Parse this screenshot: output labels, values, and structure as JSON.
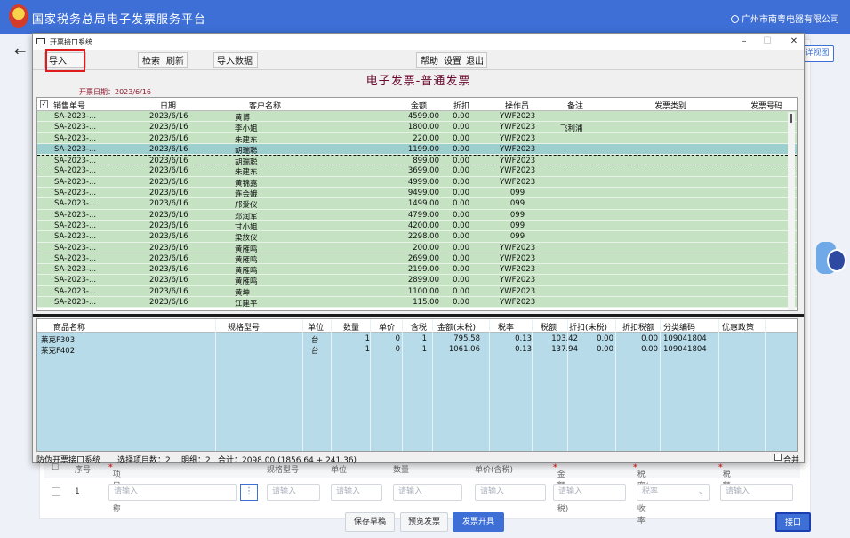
{
  "app": {
    "title": "国家税务总局电子发票服务平台",
    "user": "广州市南粤电器有限公司",
    "view_button": "详视图"
  },
  "dialog": {
    "title": "开票接口系统",
    "menu": {
      "import": "导入",
      "search": "检索",
      "refresh": "刷新",
      "import_data": "导入数据",
      "help": "帮助",
      "settings": "设置",
      "exit": "退出"
    },
    "heading": "电子发票-普通发票",
    "date_label": "开票日期：2023/6/16",
    "invoice_columns": [
      "销售单号",
      "日期",
      "客户名称",
      "金额",
      "折扣",
      "操作员",
      "备注",
      "发票类别",
      "发票号码"
    ],
    "invoices": [
      {
        "no": "SA-2023-...",
        "date": "2023/6/16",
        "customer": "黄博",
        "amount": "4599.00",
        "discount": "0.00",
        "operator": "YWF2023",
        "note": ""
      },
      {
        "no": "SA-2023-...",
        "date": "2023/6/16",
        "customer": "李小姐",
        "amount": "1800.00",
        "discount": "0.00",
        "operator": "YWF2023",
        "note": "飞利浦"
      },
      {
        "no": "SA-2023-...",
        "date": "2023/6/16",
        "customer": "朱建东",
        "amount": "220.00",
        "discount": "0.00",
        "operator": "YWF2023",
        "note": ""
      },
      {
        "no": "SA-2023-...",
        "date": "2023/6/16",
        "customer": "胡瑞聪",
        "amount": "1199.00",
        "discount": "0.00",
        "operator": "YWF2023",
        "note": ""
      },
      {
        "no": "SA-2023-...",
        "date": "2023/6/16",
        "customer": "胡瑞聪",
        "amount": "899.00",
        "discount": "0.00",
        "operator": "YWF2023",
        "note": ""
      },
      {
        "no": "SA-2023-...",
        "date": "2023/6/16",
        "customer": "朱建东",
        "amount": "3699.00",
        "discount": "0.00",
        "operator": "YWF2023",
        "note": ""
      },
      {
        "no": "SA-2023-...",
        "date": "2023/6/16",
        "customer": "黄锦嘉",
        "amount": "4999.00",
        "discount": "0.00",
        "operator": "YWF2023",
        "note": ""
      },
      {
        "no": "SA-2023-...",
        "date": "2023/6/16",
        "customer": "连会娥",
        "amount": "9499.00",
        "discount": "0.00",
        "operator": "099",
        "note": ""
      },
      {
        "no": "SA-2023-...",
        "date": "2023/6/16",
        "customer": "邝爱仪",
        "amount": "1499.00",
        "discount": "0.00",
        "operator": "099",
        "note": ""
      },
      {
        "no": "SA-2023-...",
        "date": "2023/6/16",
        "customer": "邓润军",
        "amount": "4799.00",
        "discount": "0.00",
        "operator": "099",
        "note": ""
      },
      {
        "no": "SA-2023-...",
        "date": "2023/6/16",
        "customer": "甘小姐",
        "amount": "4200.00",
        "discount": "0.00",
        "operator": "099",
        "note": ""
      },
      {
        "no": "SA-2023-...",
        "date": "2023/6/16",
        "customer": "梁放仪",
        "amount": "2298.00",
        "discount": "0.00",
        "operator": "099",
        "note": ""
      },
      {
        "no": "SA-2023-...",
        "date": "2023/6/16",
        "customer": "黄雁鸣",
        "amount": "200.00",
        "discount": "0.00",
        "operator": "YWF2023",
        "note": ""
      },
      {
        "no": "SA-2023-...",
        "date": "2023/6/16",
        "customer": "黄雁鸣",
        "amount": "2699.00",
        "discount": "0.00",
        "operator": "YWF2023",
        "note": ""
      },
      {
        "no": "SA-2023-...",
        "date": "2023/6/16",
        "customer": "黄雁鸣",
        "amount": "2199.00",
        "discount": "0.00",
        "operator": "YWF2023",
        "note": ""
      },
      {
        "no": "SA-2023-...",
        "date": "2023/6/16",
        "customer": "黄雁鸣",
        "amount": "2899.00",
        "discount": "0.00",
        "operator": "YWF2023",
        "note": ""
      },
      {
        "no": "SA-2023-...",
        "date": "2023/6/16",
        "customer": "黄坤",
        "amount": "1100.00",
        "discount": "0.00",
        "operator": "YWF2023",
        "note": ""
      },
      {
        "no": "SA-2023-...",
        "date": "2023/6/16",
        "customer": "江建平",
        "amount": "115.00",
        "discount": "0.00",
        "operator": "YWF2023",
        "note": ""
      }
    ],
    "item_columns": [
      "商品名称",
      "规格型号",
      "单位",
      "数量",
      "单价",
      "含税",
      "金额(未税)",
      "税率",
      "税额",
      "折扣(未税)",
      "折扣税额",
      "分类编码",
      "优惠政策"
    ],
    "items": [
      {
        "name": "莱克F303",
        "spec": "",
        "unit": "台",
        "qty": "1",
        "price": "0",
        "taxincl": "1",
        "amount": "795.58",
        "rate": "0.13",
        "tax": "103.42",
        "disc": "0.00",
        "disctax": "0.00",
        "code": "109041804",
        "policy": ""
      },
      {
        "name": "莱克F402",
        "spec": "",
        "unit": "台",
        "qty": "1",
        "price": "0",
        "taxincl": "1",
        "amount": "1061.06",
        "rate": "0.13",
        "tax": "137.94",
        "disc": "0.00",
        "disctax": "0.00",
        "code": "109041804",
        "policy": ""
      }
    ],
    "status": {
      "system": "防伪开票接口系统",
      "selected": "选择项目数：2",
      "details": "明细：2",
      "total": "合计：2098.00 (1856.64 + 241.36)",
      "merge": "合并"
    }
  },
  "form": {
    "headers": [
      "序号",
      "项目名称",
      "规格型号",
      "单位",
      "数量",
      "单价(含税)",
      "金额(含税)",
      "税率/征收率",
      "税额"
    ],
    "row_num": "1",
    "placeholder": "请输入",
    "rate_placeholder": "税率"
  },
  "buttons": {
    "save_draft": "保存草稿",
    "preview": "预览发票",
    "issue": "发票开具",
    "interface": "接口"
  }
}
